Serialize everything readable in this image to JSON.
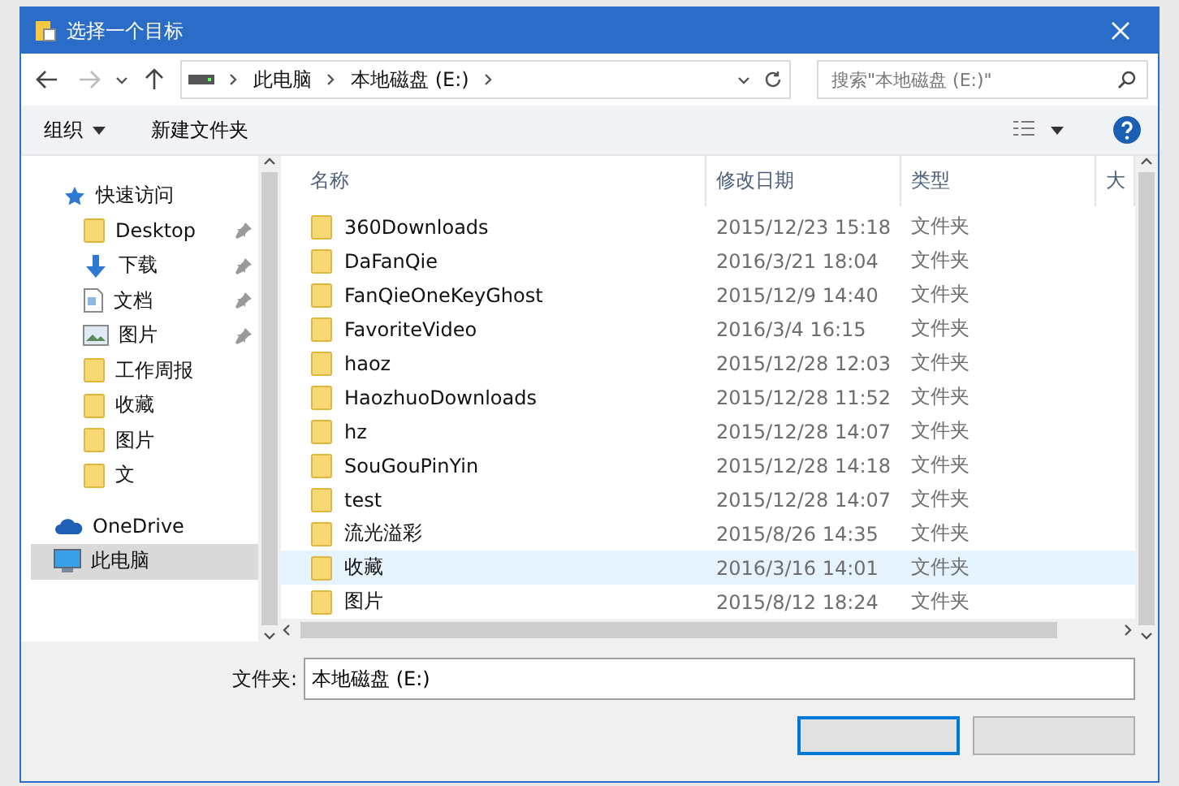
{
  "window": {
    "title": "选择一个目标"
  },
  "address": {
    "path": [
      "此电脑",
      "本地磁盘 (E:)"
    ],
    "search_placeholder": "搜索\"本地磁盘 (E:)\""
  },
  "toolbar": {
    "organize": "组织",
    "new_folder": "新建文件夹"
  },
  "sidebar": {
    "items": [
      {
        "label": "快速访问",
        "kind": "star",
        "selected": false,
        "children": [
          {
            "label": "Desktop",
            "kind": "folder",
            "pinned": true,
            "selected": false
          },
          {
            "label": "下载",
            "kind": "download",
            "pinned": true,
            "selected": false
          },
          {
            "label": "文档",
            "kind": "document",
            "pinned": true,
            "selected": false
          },
          {
            "label": "图片",
            "kind": "picture",
            "pinned": true,
            "selected": false
          },
          {
            "label": "工作周报",
            "kind": "folder",
            "pinned": false,
            "selected": false
          },
          {
            "label": "收藏",
            "kind": "folder",
            "pinned": false,
            "selected": false
          },
          {
            "label": "图片",
            "kind": "folder",
            "pinned": false,
            "selected": false
          },
          {
            "label": "文",
            "kind": "folder",
            "pinned": false,
            "selected": false
          }
        ]
      },
      {
        "label": "OneDrive",
        "kind": "cloud",
        "selected": false
      },
      {
        "label": "此电脑",
        "kind": "computer",
        "selected": true
      }
    ]
  },
  "table": {
    "columns": [
      "名称",
      "修改日期",
      "类型",
      "大"
    ],
    "rows": [
      {
        "name": "360Downloads",
        "date": "2015/12/23 15:18",
        "type": "文件夹",
        "selected": false
      },
      {
        "name": "DaFanQie",
        "date": "2016/3/21 18:04",
        "type": "文件夹",
        "selected": false
      },
      {
        "name": "FanQieOneKeyGhost",
        "date": "2015/12/9 14:40",
        "type": "文件夹",
        "selected": false
      },
      {
        "name": "FavoriteVideo",
        "date": "2016/3/4 16:15",
        "type": "文件夹",
        "selected": false
      },
      {
        "name": "haoz",
        "date": "2015/12/28 12:03",
        "type": "文件夹",
        "selected": false
      },
      {
        "name": "HaozhuoDownloads",
        "date": "2015/12/28 11:52",
        "type": "文件夹",
        "selected": false
      },
      {
        "name": "hz",
        "date": "2015/12/28 14:07",
        "type": "文件夹",
        "selected": false
      },
      {
        "name": "SouGouPinYin",
        "date": "2015/12/28 14:18",
        "type": "文件夹",
        "selected": false
      },
      {
        "name": "test",
        "date": "2015/12/28 14:07",
        "type": "文件夹",
        "selected": false
      },
      {
        "name": "流光溢彩",
        "date": "2015/8/26 14:35",
        "type": "文件夹",
        "selected": false
      },
      {
        "name": "收藏",
        "date": "2016/3/16 14:01",
        "type": "文件夹",
        "selected": true
      },
      {
        "name": "图片",
        "date": "2015/8/12 18:24",
        "type": "文件夹",
        "selected": false
      }
    ]
  },
  "folder_field": {
    "label": "文件夹:",
    "value": "本地磁盘 (E:)"
  }
}
